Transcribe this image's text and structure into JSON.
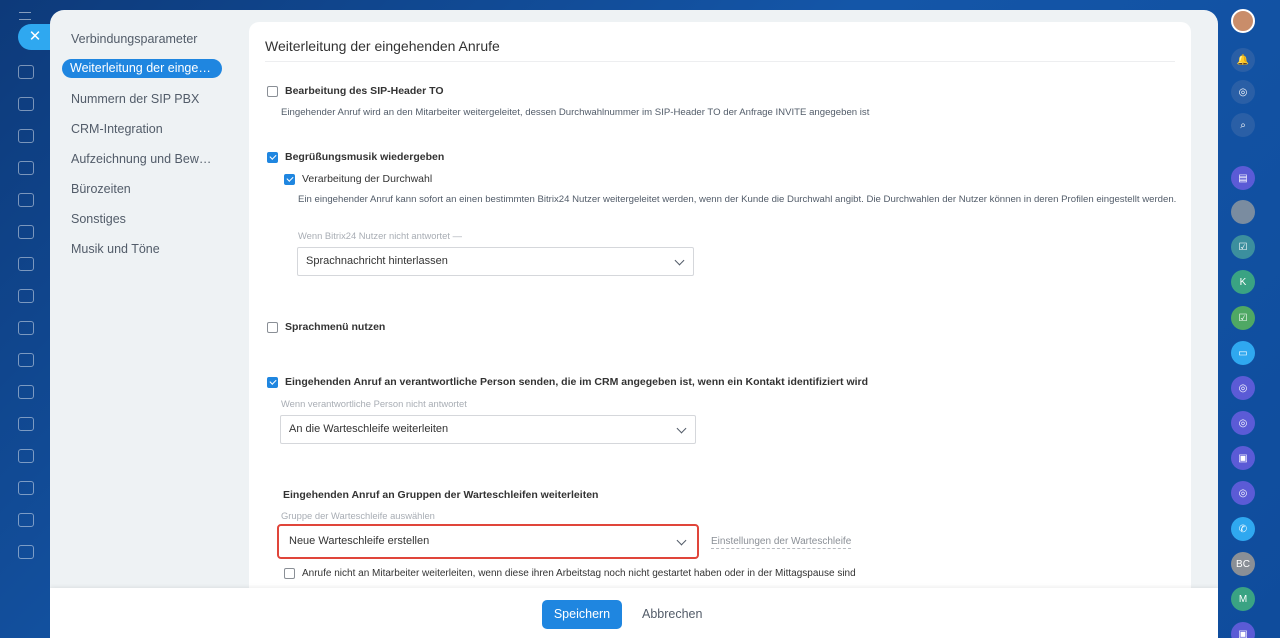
{
  "sidebar": {
    "items": [
      {
        "label": "Verbindungsparameter"
      },
      {
        "label": "Weiterleitung der eingehenden Anrufe"
      },
      {
        "label": "Nummern der SIP PBX"
      },
      {
        "label": "CRM-Integration"
      },
      {
        "label": "Aufzeichnung und Bewertung"
      },
      {
        "label": "Bürozeiten"
      },
      {
        "label": "Sonstiges"
      },
      {
        "label": "Musik und Töne"
      }
    ]
  },
  "main": {
    "title": "Weiterleitung der eingehenden Anrufe",
    "sip_header": {
      "label": "Bearbeitung des SIP-Header TO",
      "checked": false,
      "description": "Eingehender Anruf wird an den Mitarbeiter weitergeleitet, dessen Durchwahlnummer im SIP-Header TO der Anfrage INVITE angegeben ist"
    },
    "greeting": {
      "label": "Begrüßungsmusik wiedergeben",
      "checked": true,
      "extension": {
        "label": "Verarbeitung der Durchwahl",
        "checked": true,
        "description": "Ein eingehender Anruf kann sofort an einen bestimmten Bitrix24 Nutzer weitergeleitet werden, wenn der Kunde die Durchwahl angibt. Die Durchwahlen der Nutzer können in deren Profilen eingestellt werden."
      },
      "no_answer_hint": "Wenn Bitrix24 Nutzer nicht antwortet  —",
      "no_answer_value": "Sprachnachricht hinterlassen"
    },
    "ivr": {
      "label": "Sprachmenü nutzen",
      "checked": false
    },
    "responsible": {
      "label": "Eingehenden Anruf an verantwortliche Person senden, die im CRM angegeben ist, wenn ein Kontakt identifiziert wird",
      "checked": true,
      "hint": "Wenn verantwortliche Person nicht antwortet",
      "value": "An die Warteschleife weiterleiten"
    },
    "queue": {
      "heading": "Eingehenden Anruf an Gruppen der Warteschleifen weiterleiten",
      "hint": "Gruppe der Warteschleife auswählen",
      "value": "Neue Warteschleife erstellen",
      "settings_link": "Einstellungen der Warteschleife",
      "not_started": {
        "label": "Anrufe nicht an Mitarbeiter weiterleiten, wenn diese ihren Arbeitstag noch nicht gestartet haben oder in der Mittagspause sind",
        "checked": false
      }
    }
  },
  "footer": {
    "save_label": "Speichern",
    "cancel_label": "Abbrechen"
  },
  "right_rail": {
    "avatar_initials": [
      "K",
      "BC",
      "M"
    ]
  },
  "colors": {
    "accent": "#1f86e0",
    "highlight": "#e0453a"
  }
}
